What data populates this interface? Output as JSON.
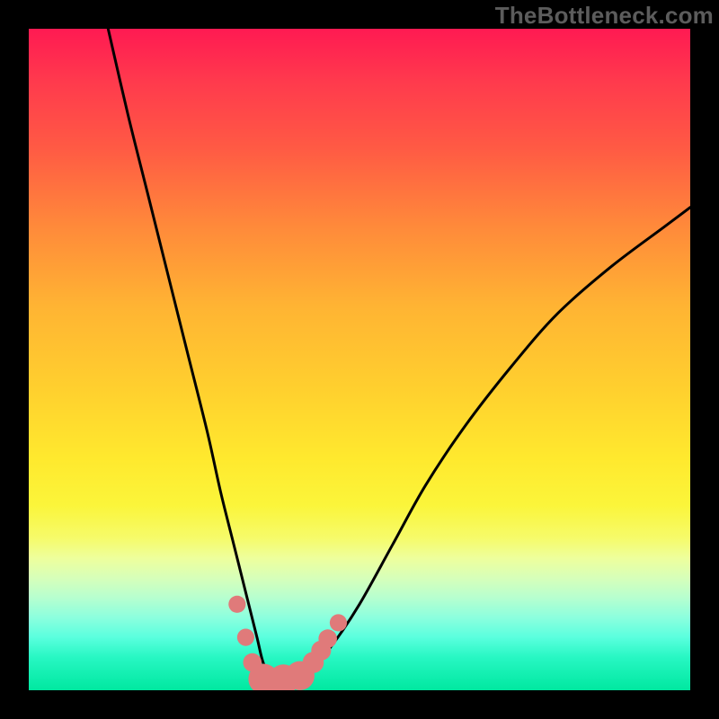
{
  "watermark": "TheBottleneck.com",
  "chart_data": {
    "type": "line",
    "title": "",
    "xlabel": "",
    "ylabel": "",
    "xlim": [
      0,
      100
    ],
    "ylim": [
      0,
      100
    ],
    "grid": false,
    "series": [
      {
        "name": "bottleneck-curve",
        "color": "#000000",
        "x": [
          12,
          15,
          18,
          21,
          24,
          27,
          29,
          31,
          33,
          34.5,
          35.5,
          37,
          39,
          41,
          43,
          46,
          50,
          55,
          60,
          66,
          73,
          80,
          88,
          96,
          100
        ],
        "y": [
          100,
          87,
          75,
          63,
          51,
          39,
          30,
          22,
          14,
          8,
          4,
          1.5,
          1.5,
          1.8,
          3.5,
          7,
          13,
          22,
          31,
          40,
          49,
          57,
          64,
          70,
          73
        ]
      },
      {
        "name": "highlight-dots",
        "color": "#e07a7a",
        "type": "scatter",
        "points": [
          {
            "x": 31.5,
            "y": 13,
            "r": 1.3
          },
          {
            "x": 32.8,
            "y": 8,
            "r": 1.3
          },
          {
            "x": 33.8,
            "y": 4.2,
            "r": 1.4
          },
          {
            "x": 35.5,
            "y": 1.7,
            "r": 2.3
          },
          {
            "x": 38.5,
            "y": 1.6,
            "r": 2.3
          },
          {
            "x": 41.0,
            "y": 2.2,
            "r": 2.2
          },
          {
            "x": 43.0,
            "y": 4.2,
            "r": 1.6
          },
          {
            "x": 44.2,
            "y": 6.0,
            "r": 1.5
          },
          {
            "x": 45.2,
            "y": 7.8,
            "r": 1.4
          },
          {
            "x": 46.8,
            "y": 10.2,
            "r": 1.3
          }
        ]
      }
    ],
    "annotations": [
      {
        "text": "TheBottleneck.com",
        "pos": "top-right"
      }
    ]
  }
}
